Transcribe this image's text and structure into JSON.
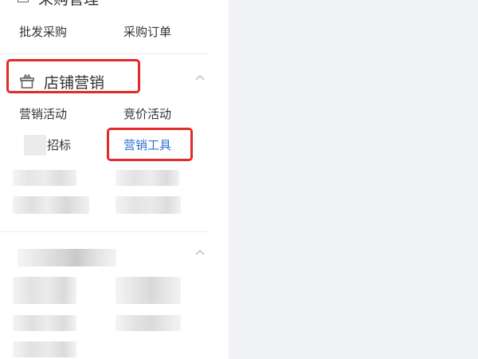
{
  "sidebar": {
    "procurement_group": {
      "title": "采购管理",
      "items": [
        "批发采购",
        "采购订单"
      ]
    },
    "store_marketing": {
      "title": "店铺营销",
      "icon": "gift-box-icon",
      "items": [
        {
          "label": "营销活动",
          "active": false
        },
        {
          "label": "竞价活动",
          "active": false
        },
        {
          "label": "招标",
          "active": false
        },
        {
          "label": "营销工具",
          "active": true
        }
      ]
    }
  },
  "colors": {
    "highlight": "#e32a2a",
    "active_text": "#2f6fd1",
    "main_background": "#f1f2f6",
    "divider": "#e9ebef"
  }
}
